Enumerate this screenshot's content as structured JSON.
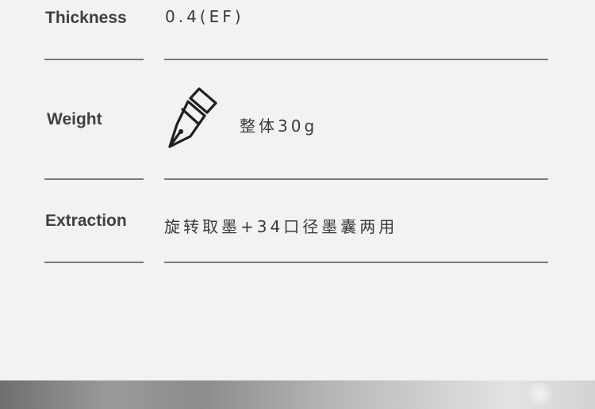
{
  "specs": {
    "thickness": {
      "label": "Thickness",
      "value": "0.4(EF)"
    },
    "weight": {
      "label": "Weight",
      "icon": "fountain-pen-nib-icon",
      "value": "整体30g"
    },
    "extraction": {
      "label": "Extraction",
      "value": "旋转取墨+34口径墨囊两用"
    }
  },
  "colors": {
    "background": "#f2f2f2",
    "text": "#3a3a3a",
    "rule": "#7a7a7a"
  }
}
